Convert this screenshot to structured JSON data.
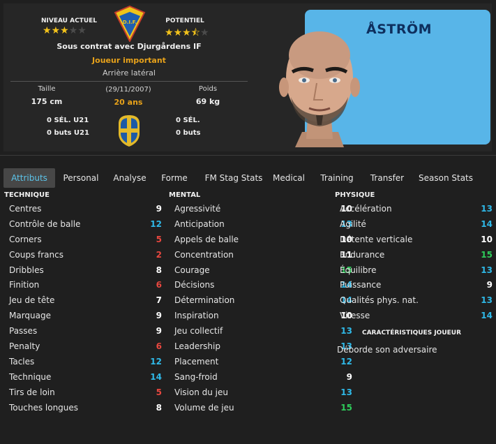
{
  "header": {
    "current_ability_label": "NIVEAU ACTUEL",
    "current_ability_stars": 3,
    "potential_label": "POTENTIEL",
    "potential_stars": 3.5,
    "contract": "Sous contrat avec Djurgårdens IF",
    "squad_status": "Joueur important",
    "position": "Arrière latéral",
    "height_label": "Taille",
    "height_value": "175 cm",
    "dob": "(29/11/2007)",
    "age": "20 ans",
    "weight_label": "Poids",
    "weight_value": "69 kg",
    "u21_caps": "0 SÉL. U21",
    "u21_goals": "0 buts U21",
    "caps": "0 SÉL.",
    "goals": "0 buts",
    "player_name": "ÅSTRÖM",
    "club_badge_text": "D.I.F."
  },
  "tabs": [
    {
      "label": "Attributs",
      "active": true
    },
    {
      "label": "Personal"
    },
    {
      "label": "Analyse"
    },
    {
      "label": "Forme"
    },
    {
      "label": "FM Stag Stats"
    },
    {
      "label": "Medical"
    },
    {
      "label": "Training"
    },
    {
      "label": "Transfer"
    },
    {
      "label": "Season Stats"
    }
  ],
  "sections": {
    "technical_title": "TECHNIQUE",
    "mental_title": "MENTAL",
    "physical_title": "PHYSIQUE",
    "traits_title": "CARACTÉRISTIQUES JOUEUR"
  },
  "technical": [
    {
      "name": "Centres",
      "value": "9",
      "color": "#ffffff"
    },
    {
      "name": "Contrôle de balle",
      "value": "12",
      "color": "#2fb9e8"
    },
    {
      "name": "Corners",
      "value": "5",
      "color": "#e8473f"
    },
    {
      "name": "Coups francs",
      "value": "2",
      "color": "#e8473f"
    },
    {
      "name": "Dribbles",
      "value": "8",
      "color": "#ffffff"
    },
    {
      "name": "Finition",
      "value": "6",
      "color": "#e8473f"
    },
    {
      "name": "Jeu de tête",
      "value": "7",
      "color": "#ffffff"
    },
    {
      "name": "Marquage",
      "value": "9",
      "color": "#ffffff"
    },
    {
      "name": "Passes",
      "value": "9",
      "color": "#ffffff"
    },
    {
      "name": "Penalty",
      "value": "6",
      "color": "#e8473f"
    },
    {
      "name": "Tacles",
      "value": "12",
      "color": "#2fb9e8"
    },
    {
      "name": "Technique",
      "value": "14",
      "color": "#2fb9e8"
    },
    {
      "name": "Tirs de loin",
      "value": "5",
      "color": "#e8473f"
    },
    {
      "name": "Touches longues",
      "value": "8",
      "color": "#ffffff"
    }
  ],
  "mental": [
    {
      "name": "Agressivité",
      "value": "10",
      "color": "#ffffff"
    },
    {
      "name": "Anticipation",
      "value": "13",
      "color": "#2fb9e8"
    },
    {
      "name": "Appels de balle",
      "value": "10",
      "color": "#ffffff"
    },
    {
      "name": "Concentration",
      "value": "11",
      "color": "#ffffff"
    },
    {
      "name": "Courage",
      "value": "15",
      "color": "#2ecc5a"
    },
    {
      "name": "Décisions",
      "value": "14",
      "color": "#2fb9e8"
    },
    {
      "name": "Détermination",
      "value": "14",
      "color": "#2fb9e8"
    },
    {
      "name": "Inspiration",
      "value": "10",
      "color": "#ffffff"
    },
    {
      "name": "Jeu collectif",
      "value": "13",
      "color": "#2fb9e8"
    },
    {
      "name": "Leadership",
      "value": "13",
      "color": "#2fb9e8"
    },
    {
      "name": "Placement",
      "value": "12",
      "color": "#2fb9e8"
    },
    {
      "name": "Sang-froid",
      "value": "9",
      "color": "#ffffff"
    },
    {
      "name": "Vision du jeu",
      "value": "13",
      "color": "#2fb9e8"
    },
    {
      "name": "Volume de jeu",
      "value": "15",
      "color": "#2ecc5a"
    }
  ],
  "physical": [
    {
      "name": "Accélération",
      "value": "13",
      "color": "#2fb9e8"
    },
    {
      "name": "Agilité",
      "value": "14",
      "color": "#2fb9e8"
    },
    {
      "name": "Détente verticale",
      "value": "10",
      "color": "#ffffff"
    },
    {
      "name": "Endurance",
      "value": "15",
      "color": "#2ecc5a"
    },
    {
      "name": "Équilibre",
      "value": "13",
      "color": "#2fb9e8"
    },
    {
      "name": "Puissance",
      "value": "9",
      "color": "#ffffff"
    },
    {
      "name": "Qualités phys. nat.",
      "value": "13",
      "color": "#2fb9e8"
    },
    {
      "name": "Vitesse",
      "value": "14",
      "color": "#2fb9e8"
    }
  ],
  "traits": [
    "Déborde son adversaire"
  ]
}
